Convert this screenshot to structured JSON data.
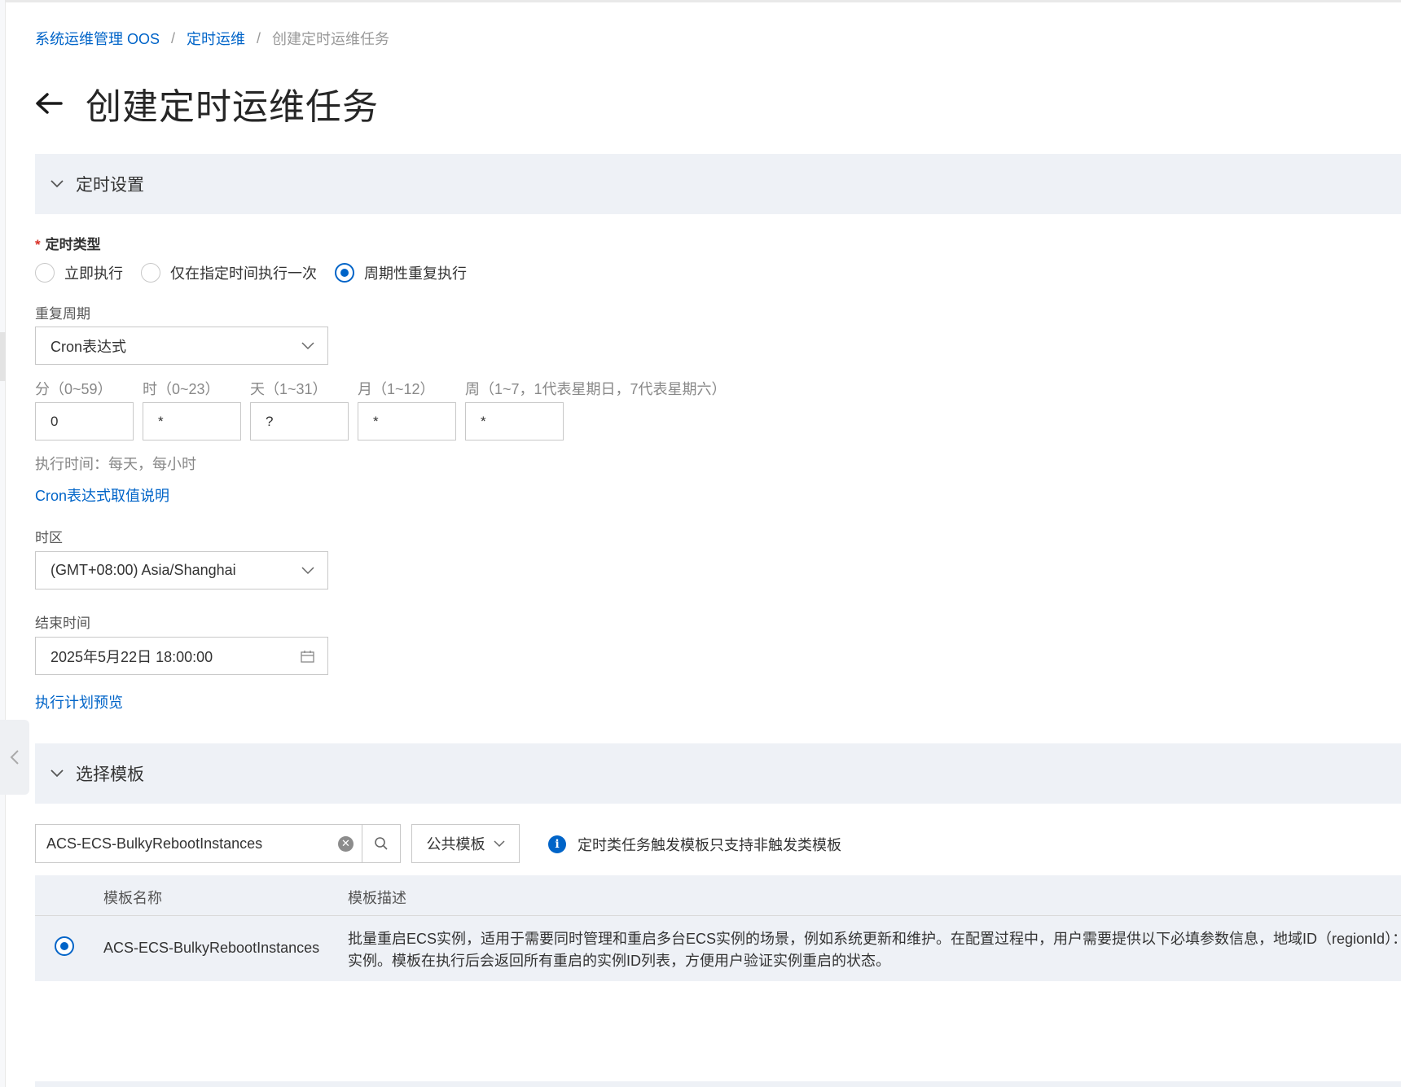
{
  "breadcrumb": {
    "items": [
      "系统运维管理 OOS",
      "定时运维",
      "创建定时运维任务"
    ],
    "separator": "/"
  },
  "page": {
    "title": "创建定时运维任务"
  },
  "sections": {
    "schedule": {
      "label": "定时设置"
    },
    "template": {
      "label": "选择模板"
    }
  },
  "schedule_type": {
    "label": "定时类型",
    "required_mark": "*",
    "options": [
      "立即执行",
      "仅在指定时间执行一次",
      "周期性重复执行"
    ],
    "selected": "周期性重复执行"
  },
  "repeat_cycle": {
    "label": "重复周期",
    "value": "Cron表达式"
  },
  "cron": {
    "fields": [
      {
        "label": "分（0~59）",
        "value": "0"
      },
      {
        "label": "时（0~23）",
        "value": "*"
      },
      {
        "label": "天（1~31）",
        "value": "?"
      },
      {
        "label": "月（1~12）",
        "value": "*"
      },
      {
        "label": "周（1~7，1代表星期日，7代表星期六）",
        "value": "*"
      }
    ],
    "exec_hint": "执行时间：每天，每小时",
    "help_link": "Cron表达式取值说明"
  },
  "timezone": {
    "label": "时区",
    "value": "(GMT+08:00) Asia/Shanghai"
  },
  "end_time": {
    "label": "结束时间",
    "value": "2025年5月22日 18:00:00"
  },
  "plan_preview_link": "执行计划预览",
  "template_search": {
    "value": "ACS-ECS-BulkyRebootInstances"
  },
  "template_filter": {
    "value": "公共模板"
  },
  "notice": {
    "text": "定时类任务触发模板只支持非触发类模板"
  },
  "table": {
    "columns": [
      "模板名称",
      "模板描述"
    ],
    "rows": [
      {
        "name": "ACS-ECS-BulkyRebootInstances",
        "desc_line1": "批量重启ECS实例，适用于需要同时管理和重启多台ECS实例的场景，例如系统更新和维护。在配置过程中，用户需要提供以下必填参数信息，地域ID（regionId）：",
        "desc_line2": "实例。模板在执行后会返回所有重启的实例ID列表，方便用户验证实例重启的状态。",
        "selected": true
      }
    ]
  },
  "colors": {
    "accent": "#0064c8",
    "section_bg": "#eef1f6",
    "required": "#d93026"
  }
}
